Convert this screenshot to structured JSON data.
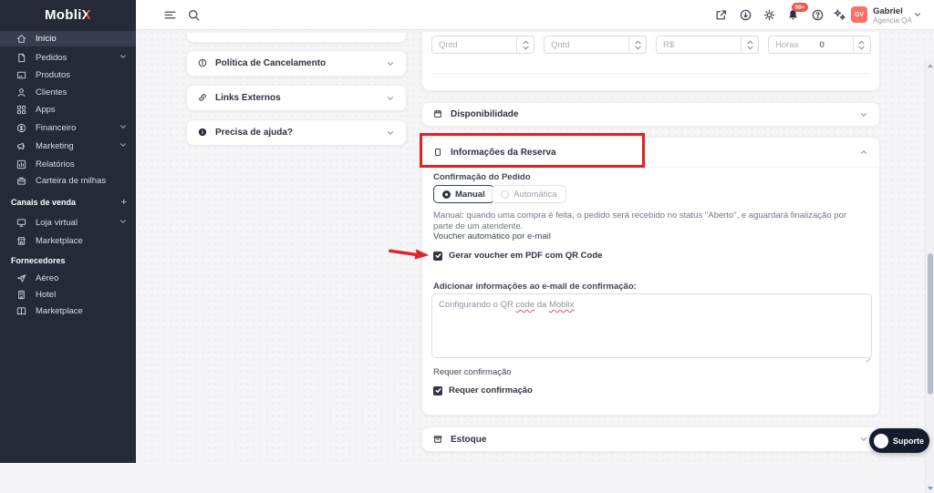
{
  "brand": {
    "logo_main": "Mobli",
    "logo_x": "X"
  },
  "sidebar": {
    "items": [
      {
        "label": "Início"
      },
      {
        "label": "Pedidos"
      },
      {
        "label": "Produtos"
      },
      {
        "label": "Clientes"
      },
      {
        "label": "Apps"
      },
      {
        "label": "Financeiro"
      },
      {
        "label": "Marketing"
      },
      {
        "label": "Relatórios"
      },
      {
        "label": "Carteira de milhas"
      },
      {
        "label": "Loja virtual"
      },
      {
        "label": "Marketplace"
      },
      {
        "label": "Aéreo"
      },
      {
        "label": "Hotel"
      },
      {
        "label": "Marketplace"
      }
    ],
    "sections": {
      "canais": "Canais de venda",
      "fornecedores": "Fornecedores"
    }
  },
  "topbar": {
    "notification_badge": "99+",
    "user": {
      "initials": "GV",
      "name": "Gabriel",
      "org": "Agencia QA"
    }
  },
  "left_panels": {
    "cancelamento": "Política de Cancelamento",
    "links": "Links Externos",
    "ajuda": "Precisa de ajuda?"
  },
  "pricing_row": {
    "qntd1_placeholder": "Qntd",
    "qntd2_placeholder": "Qntd",
    "valor_placeholder": "R$",
    "horas_label": "Horas",
    "horas_value": "0"
  },
  "panels": {
    "disponibilidade": "Disponibilidade",
    "estoque": "Estoque"
  },
  "reserva": {
    "title": "Informações da Reserva",
    "confirm_label": "Confirmação do Pedido",
    "manual_label": "Manual",
    "automatica_label": "Automática",
    "manual_help": "Manual: quando uma compra é feita, o pedido será recebido no status \"Aberto\", e aguardará finalização por parte de um atendente.",
    "voucher_section_label": "Voucher automático por e-mail",
    "voucher_checkbox_label": "Gerar voucher em PDF com QR Code",
    "email_info_label": "Adicionar informações ao e-mail de confirmação:",
    "textarea_value": {
      "p1": "Configurando o QR ",
      "w1": "code",
      "p2": " da ",
      "w2": "Moblix"
    },
    "requer_section_label": "Requer confirmação",
    "requer_checkbox_label": "Requer confirmação"
  },
  "support": {
    "label": "Suporte"
  },
  "colors": {
    "accent_red": "#e2201f",
    "brand_dark": "#262a38",
    "avatar": "#f97066"
  }
}
